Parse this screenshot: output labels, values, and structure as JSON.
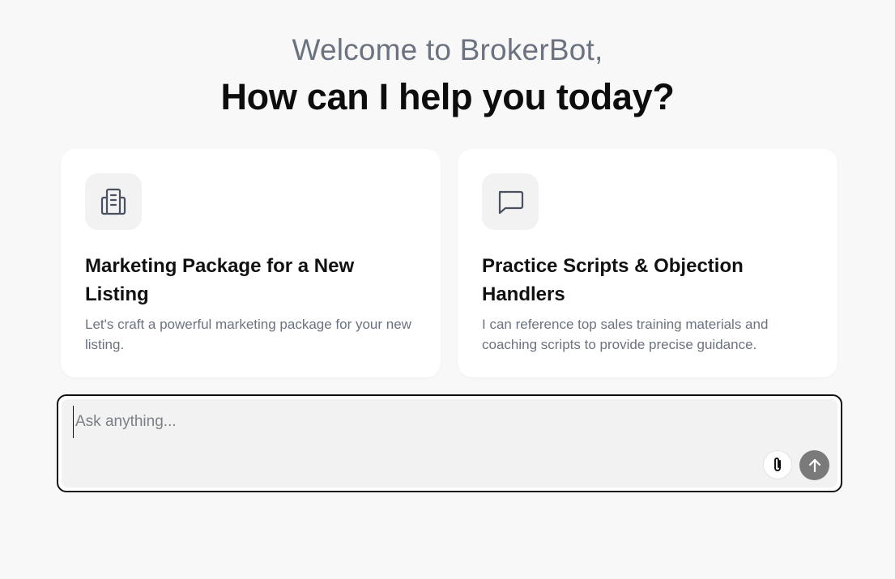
{
  "header": {
    "welcome": "Welcome to BrokerBot,",
    "headline": "How can I help you today?"
  },
  "cards": [
    {
      "icon": "building-document-icon",
      "title": "Marketing Package for a New Listing",
      "description": "Let's craft a powerful marketing package for your new listing."
    },
    {
      "icon": "chat-bubble-icon",
      "title": "Practice Scripts & Objection Handlers",
      "description": "I can reference top sales training materials and coaching scripts to provide precise guidance."
    }
  ],
  "composer": {
    "placeholder": "Ask anything...",
    "value": "",
    "attach_icon": "paperclip-icon",
    "send_icon": "arrow-up-icon"
  },
  "colors": {
    "background": "#f8f8f8",
    "card": "#ffffff",
    "muted_text": "#6b7280",
    "send_button": "#7a7a7a",
    "composer_border": "#111111"
  }
}
